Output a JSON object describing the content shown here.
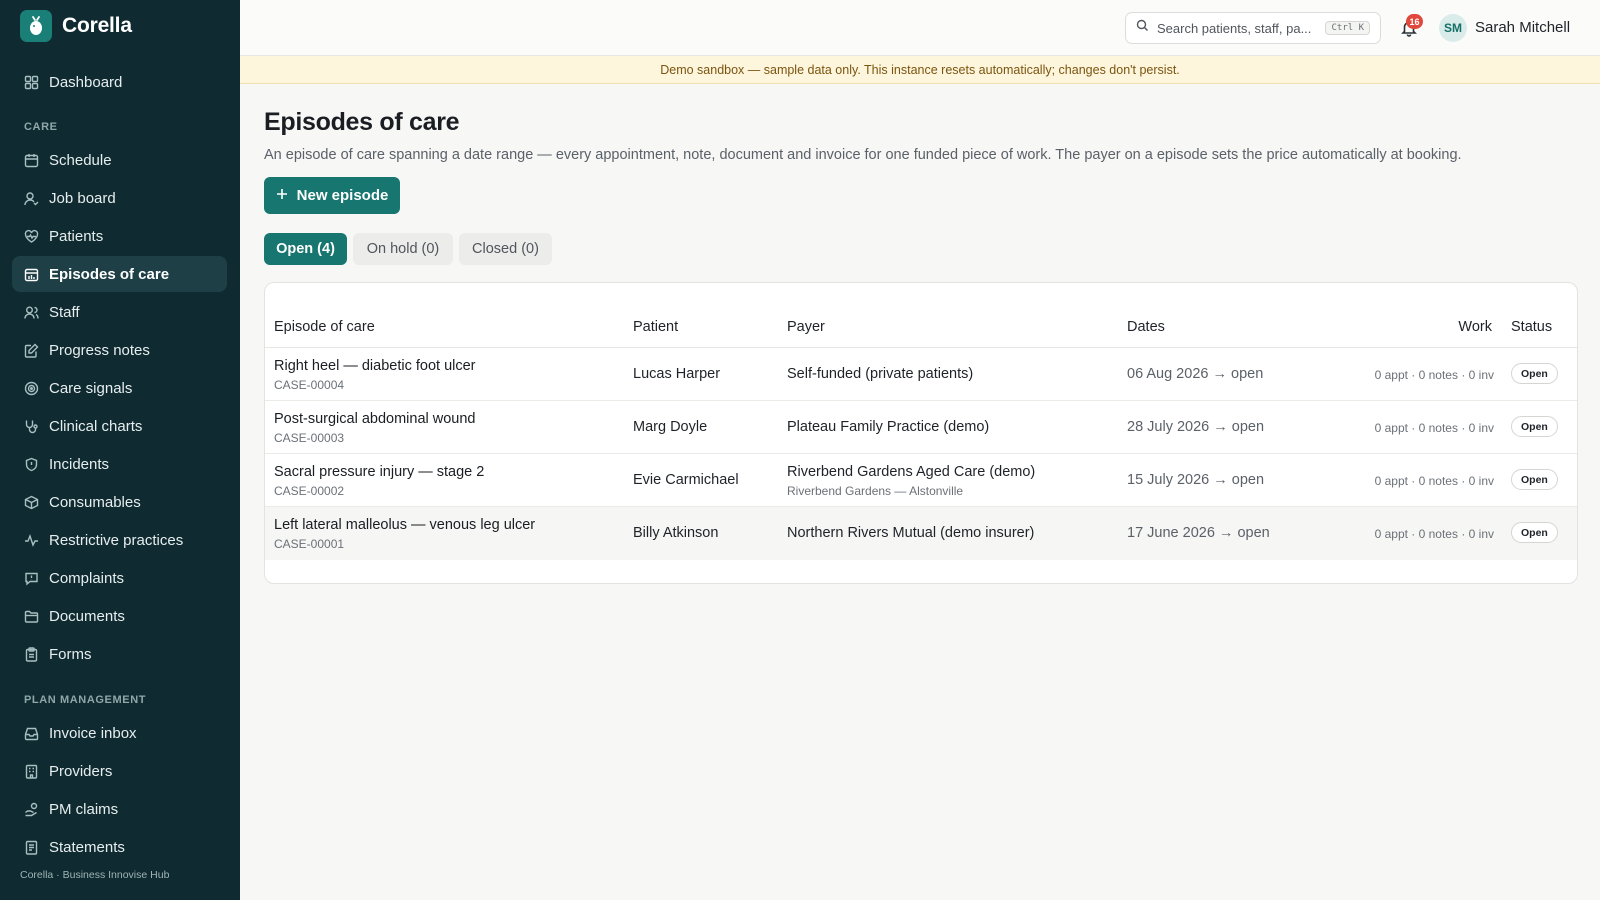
{
  "app": {
    "name": "Corella",
    "footer": "Corella · Business Innovise Hub"
  },
  "sidebar": {
    "items": [
      {
        "label": "Dashboard",
        "icon": "grid-icon"
      },
      {
        "label": "Schedule",
        "icon": "calendar-icon"
      },
      {
        "label": "Job board",
        "icon": "user-check-icon"
      },
      {
        "label": "Patients",
        "icon": "heart-pulse-icon"
      },
      {
        "label": "Episodes of care",
        "icon": "chart-calendar-icon",
        "active": true
      },
      {
        "label": "Staff",
        "icon": "users-icon"
      },
      {
        "label": "Progress notes",
        "icon": "edit-note-icon"
      },
      {
        "label": "Care signals",
        "icon": "signal-icon"
      },
      {
        "label": "Clinical charts",
        "icon": "stethoscope-icon"
      },
      {
        "label": "Incidents",
        "icon": "shield-alert-icon"
      },
      {
        "label": "Consumables",
        "icon": "package-icon"
      },
      {
        "label": "Restrictive practices",
        "icon": "activity-icon"
      },
      {
        "label": "Complaints",
        "icon": "message-alert-icon"
      },
      {
        "label": "Documents",
        "icon": "folder-icon"
      },
      {
        "label": "Forms",
        "icon": "clipboard-icon"
      },
      {
        "label": "Invoice inbox",
        "icon": "inbox-icon"
      },
      {
        "label": "Providers",
        "icon": "building-icon"
      },
      {
        "label": "PM claims",
        "icon": "hand-coins-icon"
      },
      {
        "label": "Statements",
        "icon": "receipt-icon"
      }
    ],
    "sections": {
      "care": "CARE",
      "plan": "PLAN MANAGEMENT"
    }
  },
  "topbar": {
    "search_placeholder": "Search patients, staff, pa...",
    "search_shortcut": "Ctrl K",
    "notifications_count": "16",
    "user_initials": "SM",
    "user_name": "Sarah Mitchell"
  },
  "banner": {
    "text": "Demo sandbox — sample data only. This instance resets automatically; changes don't persist."
  },
  "page": {
    "title": "Episodes of care",
    "description": "An episode of care spanning a date range — every appointment, note, document and invoice for one funded piece of work. The payer on a episode sets the price automatically at booking.",
    "new_button": "New episode"
  },
  "tabs": [
    {
      "label": "Open (4)",
      "active": true
    },
    {
      "label": "On hold (0)",
      "active": false
    },
    {
      "label": "Closed (0)",
      "active": false
    }
  ],
  "table": {
    "headers": {
      "episode": "Episode of care",
      "patient": "Patient",
      "payer": "Payer",
      "dates": "Dates",
      "work": "Work",
      "status": "Status"
    },
    "rows": [
      {
        "title": "Right heel — diabetic foot ulcer",
        "case": "CASE-00004",
        "patient": "Lucas Harper",
        "payer": "Self-funded (private patients)",
        "payer_sub": "",
        "dates": "06 Aug 2026 → open",
        "work": "0 appt · 0 notes · 0 inv",
        "status": "Open"
      },
      {
        "title": "Post-surgical abdominal wound",
        "case": "CASE-00003",
        "patient": "Marg Doyle",
        "payer": "Plateau Family Practice (demo)",
        "payer_sub": "",
        "dates": "28 July 2026 → open",
        "work": "0 appt · 0 notes · 0 inv",
        "status": "Open"
      },
      {
        "title": "Sacral pressure injury — stage 2",
        "case": "CASE-00002",
        "patient": "Evie Carmichael",
        "payer": "Riverbend Gardens Aged Care (demo)",
        "payer_sub": "Riverbend Gardens — Alstonville",
        "dates": "15 July 2026 → open",
        "work": "0 appt · 0 notes · 0 inv",
        "status": "Open"
      },
      {
        "title": "Left lateral malleolus — venous leg ulcer",
        "case": "CASE-00001",
        "patient": "Billy Atkinson",
        "payer": "Northern Rivers Mutual (demo insurer)",
        "payer_sub": "",
        "dates": "17 June 2026 → open",
        "work": "0 appt · 0 notes · 0 inv",
        "status": "Open"
      }
    ]
  },
  "colors": {
    "sidebar_bg": "#0f2a30",
    "accent": "#17766f",
    "banner_bg": "#fdf6dc",
    "badge": "#e0483e"
  }
}
